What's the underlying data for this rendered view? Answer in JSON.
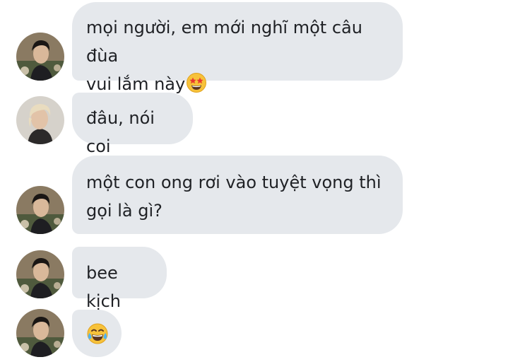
{
  "messages": [
    {
      "text": "mọi người, em mới nghĩ một câu đùa\nvui lắm này",
      "emoji": "star-struck-emoji",
      "avatar": "avatar-person-dark-hair"
    },
    {
      "text": "đâu, nói coi",
      "avatar": "avatar-person-blond-hair"
    },
    {
      "text": "một con ong rơi vào tuyệt vọng thì\ngọi là gì?",
      "avatar": "avatar-person-dark-hair"
    },
    {
      "text": "bee kịch",
      "avatar": "avatar-person-dark-hair"
    },
    {
      "text": "",
      "emoji": "tears-of-joy-emoji",
      "avatar": "avatar-person-dark-hair"
    }
  ],
  "colors": {
    "bubble": "#e5e8ec",
    "text": "#1f2125",
    "background": "#ffffff"
  }
}
